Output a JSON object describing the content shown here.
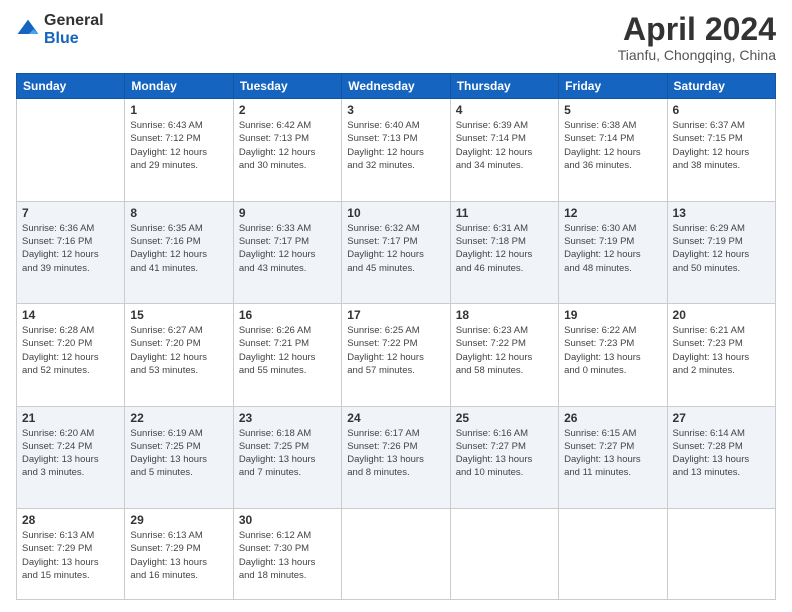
{
  "header": {
    "logo_general": "General",
    "logo_blue": "Blue",
    "month_title": "April 2024",
    "subtitle": "Tianfu, Chongqing, China"
  },
  "weekdays": [
    "Sunday",
    "Monday",
    "Tuesday",
    "Wednesday",
    "Thursday",
    "Friday",
    "Saturday"
  ],
  "weeks": [
    [
      {
        "day": "",
        "info": ""
      },
      {
        "day": "1",
        "info": "Sunrise: 6:43 AM\nSunset: 7:12 PM\nDaylight: 12 hours\nand 29 minutes."
      },
      {
        "day": "2",
        "info": "Sunrise: 6:42 AM\nSunset: 7:13 PM\nDaylight: 12 hours\nand 30 minutes."
      },
      {
        "day": "3",
        "info": "Sunrise: 6:40 AM\nSunset: 7:13 PM\nDaylight: 12 hours\nand 32 minutes."
      },
      {
        "day": "4",
        "info": "Sunrise: 6:39 AM\nSunset: 7:14 PM\nDaylight: 12 hours\nand 34 minutes."
      },
      {
        "day": "5",
        "info": "Sunrise: 6:38 AM\nSunset: 7:14 PM\nDaylight: 12 hours\nand 36 minutes."
      },
      {
        "day": "6",
        "info": "Sunrise: 6:37 AM\nSunset: 7:15 PM\nDaylight: 12 hours\nand 38 minutes."
      }
    ],
    [
      {
        "day": "7",
        "info": "Sunrise: 6:36 AM\nSunset: 7:16 PM\nDaylight: 12 hours\nand 39 minutes."
      },
      {
        "day": "8",
        "info": "Sunrise: 6:35 AM\nSunset: 7:16 PM\nDaylight: 12 hours\nand 41 minutes."
      },
      {
        "day": "9",
        "info": "Sunrise: 6:33 AM\nSunset: 7:17 PM\nDaylight: 12 hours\nand 43 minutes."
      },
      {
        "day": "10",
        "info": "Sunrise: 6:32 AM\nSunset: 7:17 PM\nDaylight: 12 hours\nand 45 minutes."
      },
      {
        "day": "11",
        "info": "Sunrise: 6:31 AM\nSunset: 7:18 PM\nDaylight: 12 hours\nand 46 minutes."
      },
      {
        "day": "12",
        "info": "Sunrise: 6:30 AM\nSunset: 7:19 PM\nDaylight: 12 hours\nand 48 minutes."
      },
      {
        "day": "13",
        "info": "Sunrise: 6:29 AM\nSunset: 7:19 PM\nDaylight: 12 hours\nand 50 minutes."
      }
    ],
    [
      {
        "day": "14",
        "info": "Sunrise: 6:28 AM\nSunset: 7:20 PM\nDaylight: 12 hours\nand 52 minutes."
      },
      {
        "day": "15",
        "info": "Sunrise: 6:27 AM\nSunset: 7:20 PM\nDaylight: 12 hours\nand 53 minutes."
      },
      {
        "day": "16",
        "info": "Sunrise: 6:26 AM\nSunset: 7:21 PM\nDaylight: 12 hours\nand 55 minutes."
      },
      {
        "day": "17",
        "info": "Sunrise: 6:25 AM\nSunset: 7:22 PM\nDaylight: 12 hours\nand 57 minutes."
      },
      {
        "day": "18",
        "info": "Sunrise: 6:23 AM\nSunset: 7:22 PM\nDaylight: 12 hours\nand 58 minutes."
      },
      {
        "day": "19",
        "info": "Sunrise: 6:22 AM\nSunset: 7:23 PM\nDaylight: 13 hours\nand 0 minutes."
      },
      {
        "day": "20",
        "info": "Sunrise: 6:21 AM\nSunset: 7:23 PM\nDaylight: 13 hours\nand 2 minutes."
      }
    ],
    [
      {
        "day": "21",
        "info": "Sunrise: 6:20 AM\nSunset: 7:24 PM\nDaylight: 13 hours\nand 3 minutes."
      },
      {
        "day": "22",
        "info": "Sunrise: 6:19 AM\nSunset: 7:25 PM\nDaylight: 13 hours\nand 5 minutes."
      },
      {
        "day": "23",
        "info": "Sunrise: 6:18 AM\nSunset: 7:25 PM\nDaylight: 13 hours\nand 7 minutes."
      },
      {
        "day": "24",
        "info": "Sunrise: 6:17 AM\nSunset: 7:26 PM\nDaylight: 13 hours\nand 8 minutes."
      },
      {
        "day": "25",
        "info": "Sunrise: 6:16 AM\nSunset: 7:27 PM\nDaylight: 13 hours\nand 10 minutes."
      },
      {
        "day": "26",
        "info": "Sunrise: 6:15 AM\nSunset: 7:27 PM\nDaylight: 13 hours\nand 11 minutes."
      },
      {
        "day": "27",
        "info": "Sunrise: 6:14 AM\nSunset: 7:28 PM\nDaylight: 13 hours\nand 13 minutes."
      }
    ],
    [
      {
        "day": "28",
        "info": "Sunrise: 6:13 AM\nSunset: 7:29 PM\nDaylight: 13 hours\nand 15 minutes."
      },
      {
        "day": "29",
        "info": "Sunrise: 6:13 AM\nSunset: 7:29 PM\nDaylight: 13 hours\nand 16 minutes."
      },
      {
        "day": "30",
        "info": "Sunrise: 6:12 AM\nSunset: 7:30 PM\nDaylight: 13 hours\nand 18 minutes."
      },
      {
        "day": "",
        "info": ""
      },
      {
        "day": "",
        "info": ""
      },
      {
        "day": "",
        "info": ""
      },
      {
        "day": "",
        "info": ""
      }
    ]
  ]
}
